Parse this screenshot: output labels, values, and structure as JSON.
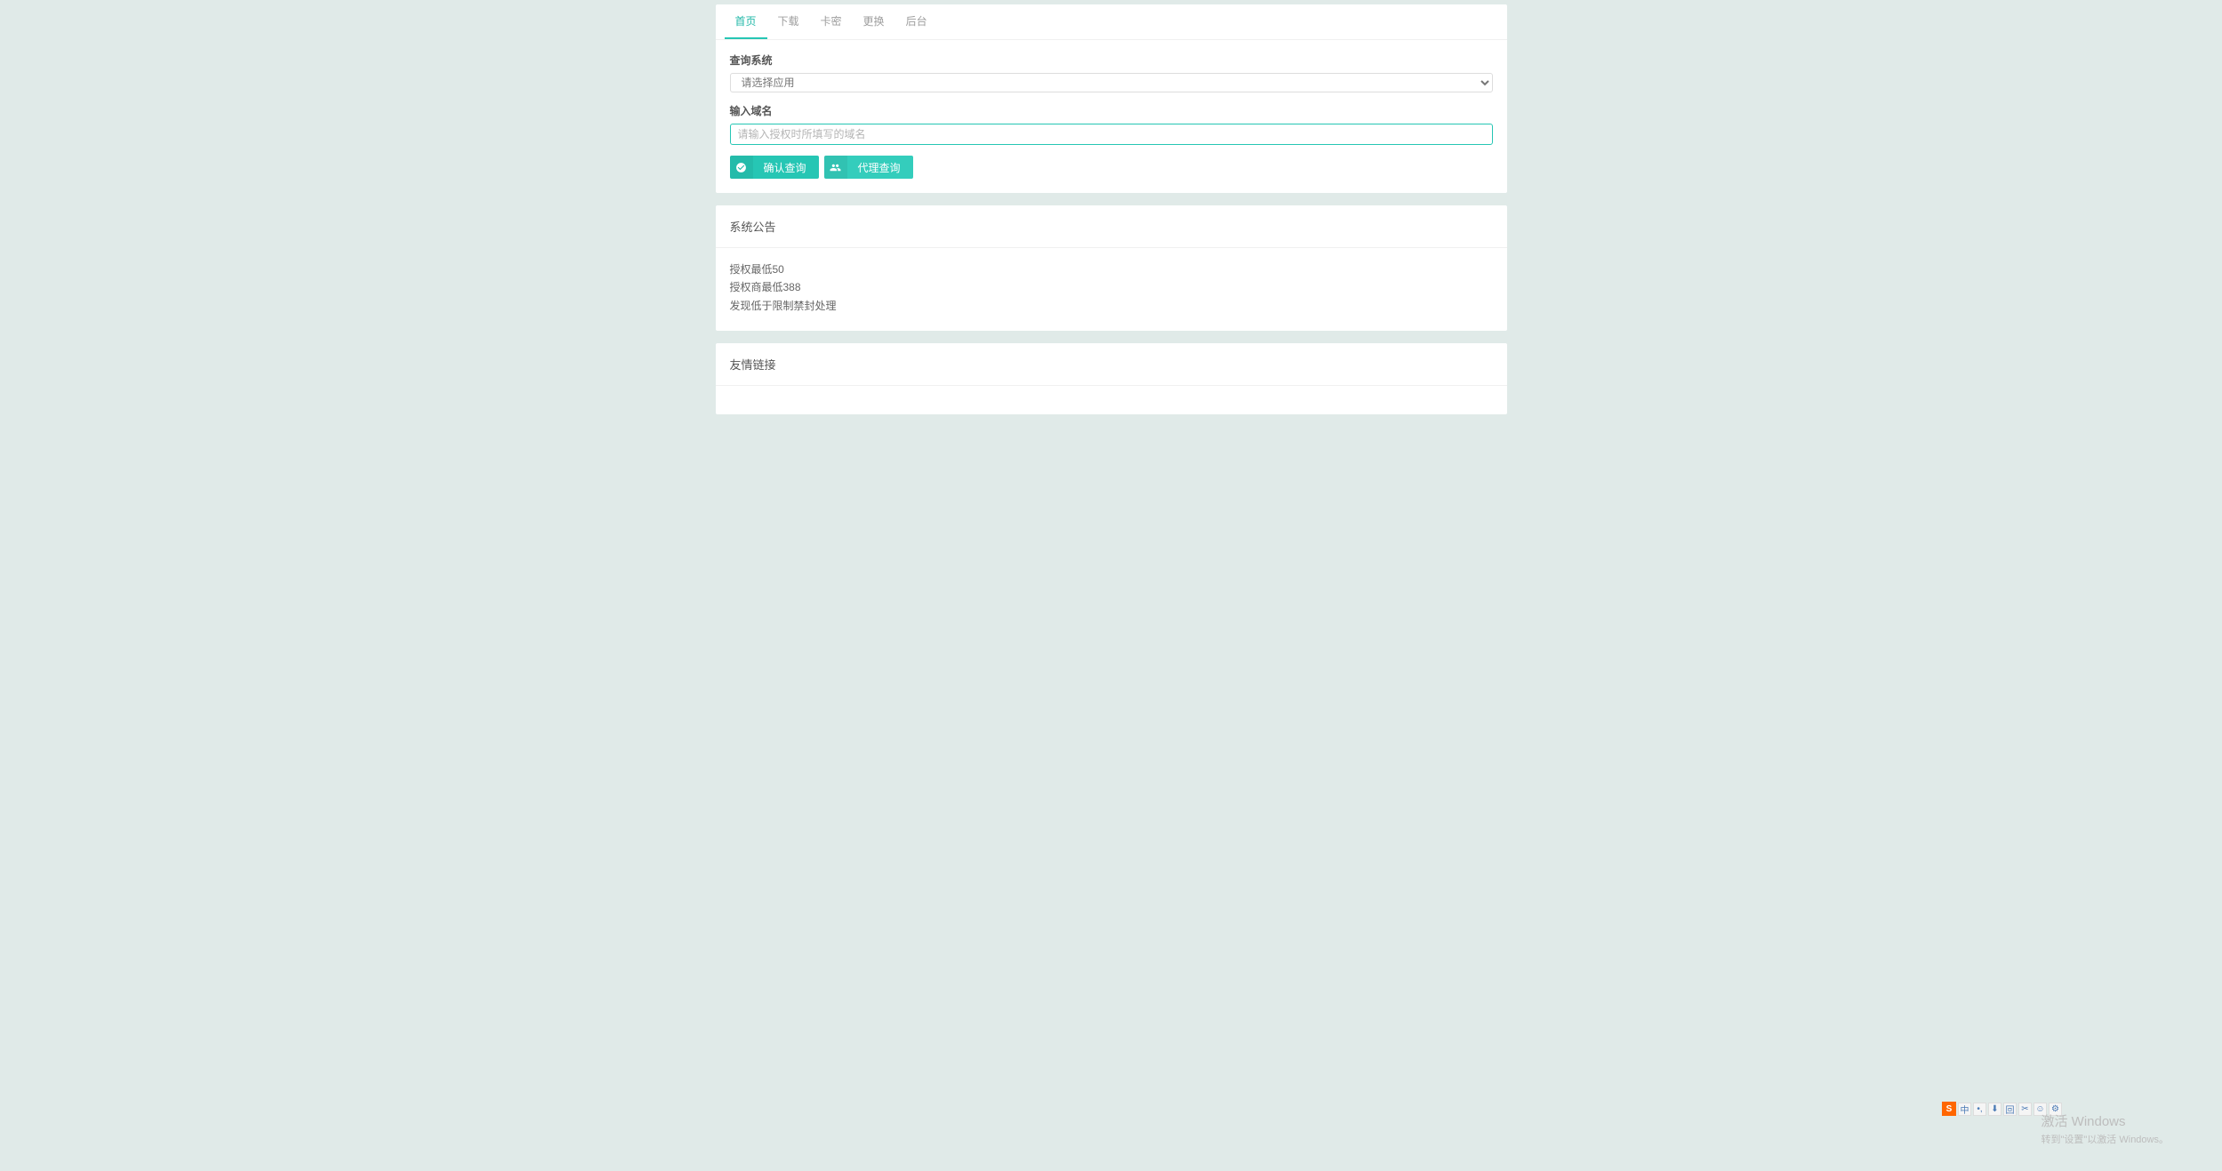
{
  "tabs": {
    "items": [
      {
        "label": "首页",
        "active": true
      },
      {
        "label": "下载",
        "active": false
      },
      {
        "label": "卡密",
        "active": false
      },
      {
        "label": "更换",
        "active": false
      },
      {
        "label": "后台",
        "active": false
      }
    ]
  },
  "form": {
    "system_label": "查询系统",
    "system_select_placeholder": "请选择应用",
    "domain_label": "输入域名",
    "domain_placeholder": "请输入授权时所填写的域名",
    "confirm_button": "确认查询",
    "agent_button": "代理查询"
  },
  "announcement": {
    "title": "系统公告",
    "lines": [
      "授权最低50",
      "授权商最低388",
      "发现低于限制禁封处理"
    ]
  },
  "friendlinks": {
    "title": "友情链接"
  },
  "watermark": {
    "line1": "激活 Windows",
    "line2": "转到\"设置\"以激活 Windows。"
  },
  "ime": {
    "logo": "S",
    "items": [
      "中",
      "•,",
      "⬇",
      "回",
      "✂",
      "☺",
      "⚙"
    ]
  }
}
